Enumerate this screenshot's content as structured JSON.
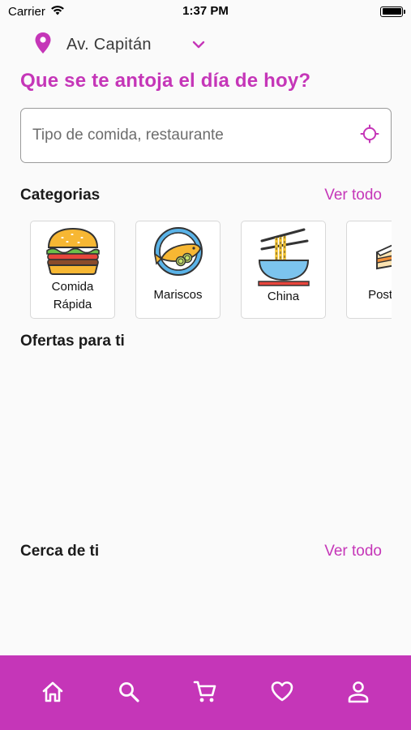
{
  "status_bar": {
    "carrier": "Carrier",
    "time": "1:37 PM"
  },
  "location": {
    "label": "Av. Capitán",
    "icon": "map-pin-icon",
    "dropdown_icon": "chevron-down-icon"
  },
  "headline": "Que se te antoja el día de hoy?",
  "search": {
    "placeholder": "Tipo de comida, restaurante",
    "value": "",
    "icon": "crosshair-icon"
  },
  "categories": {
    "title": "Categorias",
    "see_all": "Ver todo",
    "items": [
      {
        "label": "Comida Rápida",
        "icon": "burger-icon"
      },
      {
        "label": "Mariscos",
        "icon": "fish-plate-icon"
      },
      {
        "label": "China",
        "icon": "noodles-bowl-icon"
      },
      {
        "label": "Postres",
        "icon": "cake-icon"
      }
    ]
  },
  "offers": {
    "title": "Ofertas para ti"
  },
  "nearby": {
    "title": "Cerca de ti",
    "see_all": "Ver todo"
  },
  "tabbar": {
    "items": [
      {
        "name": "home",
        "icon": "home-icon"
      },
      {
        "name": "search",
        "icon": "search-icon"
      },
      {
        "name": "cart",
        "icon": "cart-icon"
      },
      {
        "name": "favorites",
        "icon": "heart-icon"
      },
      {
        "name": "profile",
        "icon": "user-icon"
      }
    ]
  },
  "colors": {
    "accent": "#c536b8",
    "background": "#fafafa"
  }
}
